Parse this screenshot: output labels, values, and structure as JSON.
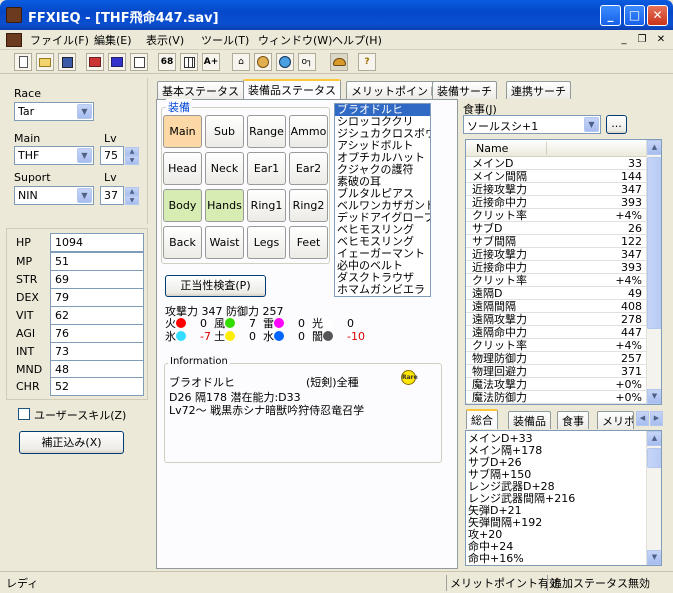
{
  "window": {
    "title": "FFXIEQ - [THF飛命447.sav]"
  },
  "menu": {
    "items": [
      "ファイル(F)",
      "編集(E)",
      "表示(V)",
      "ツール(T)",
      "ウィンドウ(W)",
      "ヘルプ(H)"
    ]
  },
  "toolbar": {
    "buttons": [
      {
        "label": "",
        "icon": "new-file-icon"
      },
      {
        "label": "",
        "icon": "open-folder-icon"
      },
      {
        "label": "",
        "icon": "save-icon"
      },
      {
        "label": "",
        "icon": "book-red-icon"
      },
      {
        "label": "",
        "icon": "book-blue-icon"
      },
      {
        "label": "",
        "icon": "edit-icon"
      },
      {
        "label": "68",
        "icon": "68-icon"
      },
      {
        "label": "",
        "icon": "grid-icon"
      },
      {
        "label": "A+",
        "icon": "a-plus-icon"
      },
      {
        "label": "",
        "icon": "house-icon"
      },
      {
        "label": "",
        "icon": "globe-icon"
      },
      {
        "label": "",
        "icon": "orb-icon"
      },
      {
        "label": "o┐",
        "icon": "key-icon"
      },
      {
        "label": "",
        "icon": "food-icon"
      },
      {
        "label": "?",
        "icon": "help-icon"
      }
    ]
  },
  "character": {
    "race_label": "Race",
    "race_value": "Tar",
    "main_label": "Main",
    "main_value": "THF",
    "main_lv_label": "Lv",
    "main_lv_value": "75",
    "support_label": "Suport",
    "support_value": "NIN",
    "support_lv_label": "Lv",
    "support_lv_value": "37"
  },
  "stats": [
    {
      "name": "HP",
      "value": "1094"
    },
    {
      "name": "MP",
      "value": "51"
    },
    {
      "name": "STR",
      "value": "69"
    },
    {
      "name": "DEX",
      "value": "79"
    },
    {
      "name": "VIT",
      "value": "62"
    },
    {
      "name": "AGI",
      "value": "76"
    },
    {
      "name": "INT",
      "value": "73"
    },
    {
      "name": "MND",
      "value": "48"
    },
    {
      "name": "CHR",
      "value": "52"
    }
  ],
  "user_skill": {
    "label": "ユーザースキル(Z)",
    "checked": false
  },
  "correction_button": "補正込み(X)",
  "tabs": [
    "基本ステータス",
    "装備品ステータス",
    "メリットポイント",
    "装備サーチ",
    "連携サーチ"
  ],
  "active_tab": 1,
  "equip_group_label": "装備",
  "equipment_slots": [
    {
      "label": "Main",
      "state": "orange"
    },
    {
      "label": "Sub",
      "state": "normal"
    },
    {
      "label": "Range",
      "state": "normal"
    },
    {
      "label": "Ammo",
      "state": "normal"
    },
    {
      "label": "Head",
      "state": "normal"
    },
    {
      "label": "Neck",
      "state": "normal"
    },
    {
      "label": "Ear1",
      "state": "normal"
    },
    {
      "label": "Ear2",
      "state": "normal"
    },
    {
      "label": "Body",
      "state": "green"
    },
    {
      "label": "Hands",
      "state": "green"
    },
    {
      "label": "Ring1",
      "state": "normal"
    },
    {
      "label": "Ring2",
      "state": "normal"
    },
    {
      "label": "Back",
      "state": "normal"
    },
    {
      "label": "Waist",
      "state": "normal"
    },
    {
      "label": "Legs",
      "state": "normal"
    },
    {
      "label": "Feet",
      "state": "normal"
    }
  ],
  "validity_button": "正当性検査(P)",
  "item_list": {
    "items": [
      "ブラオドルヒ",
      "シロッコククリ",
      "ジシュカクロスボウ",
      "アシッドボルト",
      "オプチカルハット",
      "クジャクの護符",
      "素破の耳",
      "ブルタルピアス",
      "ベルワンカザガンド",
      "デッドアイグローブ",
      "ベヒモスリング",
      "ベヒモスリング",
      "イェーガーマント",
      "必中のベルト",
      "ダスクトラウザ",
      "ホマムガンビエラ"
    ],
    "selected": 0
  },
  "summary": {
    "attack_label": "攻撃力",
    "attack_value": "347",
    "defense_label": "防御力",
    "defense_value": "257",
    "elements": [
      {
        "name": "火",
        "value": "0",
        "color": "#ff0000",
        "negative": false
      },
      {
        "name": "風",
        "value": "7",
        "color": "#33dd00",
        "negative": false
      },
      {
        "name": "雷",
        "value": "0",
        "color": "#ff00ff",
        "negative": false
      },
      {
        "name": "光",
        "value": "0",
        "color": "#ffffff",
        "negative": false
      },
      {
        "name": "氷",
        "value": "-7",
        "color": "#33ddff",
        "negative": true
      },
      {
        "name": "土",
        "value": "0",
        "color": "#ffee00",
        "negative": false
      },
      {
        "name": "水",
        "value": "0",
        "color": "#0066ff",
        "negative": false
      },
      {
        "name": "闇",
        "value": "-10",
        "color": "#555555",
        "negative": true
      }
    ]
  },
  "information": {
    "label": "Information",
    "item_name": "ブラオドルヒ",
    "category": "(短剣)全種",
    "badge": "Rare",
    "line1": "D26 隔178 潜在能力:D33",
    "line2": "Lv72～ 戦黒赤シナ暗獣吟狩侍忍竜召学"
  },
  "food": {
    "label": "食事(J)",
    "value": "ソールスシ+1",
    "browse_button": "...",
    "column_header": "Name"
  },
  "stat_table": [
    {
      "name": "メインD",
      "value": "33"
    },
    {
      "name": "メイン間隔",
      "value": "144"
    },
    {
      "name": "近接攻撃力",
      "value": "347"
    },
    {
      "name": "近接命中力",
      "value": "393"
    },
    {
      "name": "クリット率",
      "value": "+4%"
    },
    {
      "name": "サブD",
      "value": "26"
    },
    {
      "name": "サブ間隔",
      "value": "122"
    },
    {
      "name": "近接攻撃力",
      "value": "347"
    },
    {
      "name": "近接命中力",
      "value": "393"
    },
    {
      "name": "クリット率",
      "value": "+4%"
    },
    {
      "name": "遠隔D",
      "value": "49"
    },
    {
      "name": "遠隔間隔",
      "value": "408"
    },
    {
      "name": "遠隔攻撃力",
      "value": "278"
    },
    {
      "name": "遠隔命中力",
      "value": "447"
    },
    {
      "name": "クリット率",
      "value": "+4%"
    },
    {
      "name": "物理防御力",
      "value": "257"
    },
    {
      "name": "物理回避力",
      "value": "371"
    },
    {
      "name": "魔法攻撃力",
      "value": "+0%"
    },
    {
      "name": "魔法防御力",
      "value": "+0%"
    }
  ],
  "bottom_tabs": [
    "総合",
    "装備品",
    "食事",
    "メリポ"
  ],
  "bottom_active_tab": 0,
  "bonus_list": [
    "メインD+33",
    "メイン隔+178",
    "サブD+26",
    "サブ隔+150",
    "レンジ武器D+28",
    "レンジ武器間隔+216",
    "矢弾D+21",
    "矢弾間隔+192",
    "攻+20",
    "命中+24",
    "命中+16%"
  ],
  "statusbar": {
    "left": "レディ",
    "merit": "メリットポイント有効",
    "extra": "追加ステータス無効"
  }
}
